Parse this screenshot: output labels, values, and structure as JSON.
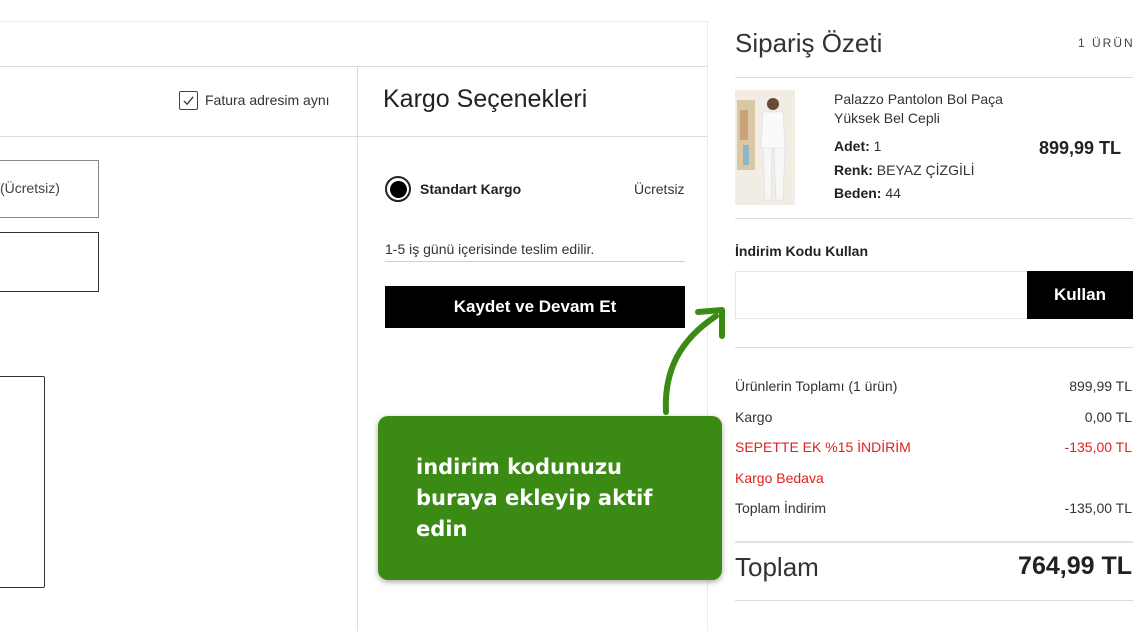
{
  "billing": {
    "same_address_label": "Fatura adresim aynı",
    "same_address_checked": true
  },
  "left_shipping_option": {
    "label": "(Ücretsiz)"
  },
  "kargo": {
    "title": "Kargo Seçenekleri",
    "option_label": "Standart Kargo",
    "option_price": "Ücretsiz",
    "delivery_text": "1-5 iş günü içerisinde teslim edilir.",
    "save_button": "Kaydet ve Devam Et"
  },
  "summary": {
    "title": "Sipariş Özeti",
    "item_count": "1 ÜRÜN",
    "product": {
      "name": "Palazzo Pantolon Bol Paça Yüksek Bel Cepli",
      "qty_label": "Adet:",
      "qty": "1",
      "color_label": "Renk:",
      "color": "BEYAZ ÇİZGİLİ",
      "size_label": "Beden:",
      "size": "44",
      "price": "899,99 TL"
    },
    "discount": {
      "label": "İndirim Kodu Kullan",
      "input_value": "",
      "apply_button": "Kullan"
    },
    "rows": [
      {
        "label": "Ürünlerin Toplamı (1 ürün)",
        "value": "899,99 TL"
      },
      {
        "label": "Kargo",
        "value": "0,00 TL"
      },
      {
        "label": "SEPETTE EK %15 İNDİRİM",
        "value": "-135,00 TL"
      },
      {
        "label": "Kargo Bedava",
        "value": ""
      },
      {
        "label": "Toplam İndirim",
        "value": "-135,00 TL"
      }
    ],
    "total_label": "Toplam",
    "total_value": "764,99 TL"
  },
  "callout": {
    "text": "indirim kodunuzu buraya ekleyip aktif edin"
  },
  "colors": {
    "accent_green": "#3a8a14",
    "discount_red": "#e02020",
    "button_black": "#000000"
  }
}
